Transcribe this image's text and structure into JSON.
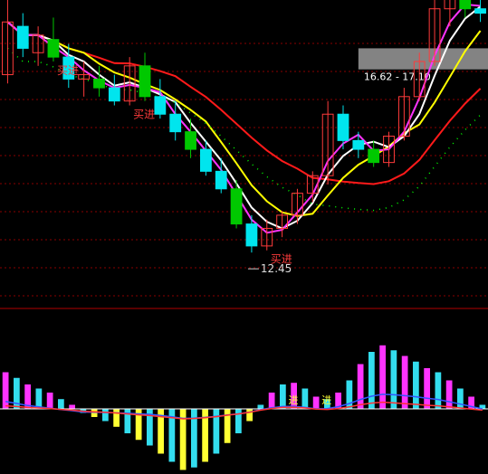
{
  "chart_data": [
    {
      "type": "candlestick",
      "title": "",
      "ylim": [
        11.3,
        18.2
      ],
      "grid": true,
      "colors": {
        "up": "#ff3b3b",
        "down": "#00e5ee",
        "down_alt": "#00c800",
        "ma_white": "#ffffff",
        "ma_yellow": "#ffff00",
        "ma_magenta": "#ff33ff",
        "ma_red": "#ff1a1a",
        "band_green": "#00ff00",
        "zone_gray": "#9a9a9a",
        "grid": "#8a0000"
      },
      "candles": [
        {
          "o": 16.5,
          "h": 18.4,
          "l": 16.3,
          "c": 17.7
        },
        {
          "o": 17.6,
          "h": 17.9,
          "l": 16.9,
          "c": 17.1
        },
        {
          "o": 17.0,
          "h": 17.6,
          "l": 16.7,
          "c": 17.4
        },
        {
          "o": 17.3,
          "h": 17.8,
          "l": 16.8,
          "c": 16.9
        },
        {
          "o": 16.9,
          "h": 17.2,
          "l": 16.2,
          "c": 16.4
        },
        {
          "o": 16.4,
          "h": 16.8,
          "l": 16.0,
          "c": 16.5
        },
        {
          "o": 16.4,
          "h": 16.7,
          "l": 16.0,
          "c": 16.2
        },
        {
          "o": 16.2,
          "h": 16.5,
          "l": 15.8,
          "c": 15.9
        },
        {
          "o": 15.9,
          "h": 16.9,
          "l": 15.8,
          "c": 16.7
        },
        {
          "o": 16.7,
          "h": 17.0,
          "l": 15.9,
          "c": 16.0
        },
        {
          "o": 16.0,
          "h": 16.4,
          "l": 15.5,
          "c": 15.6
        },
        {
          "o": 15.6,
          "h": 15.9,
          "l": 15.0,
          "c": 15.2
        },
        {
          "o": 15.2,
          "h": 15.5,
          "l": 14.6,
          "c": 14.8
        },
        {
          "o": 14.8,
          "h": 15.0,
          "l": 14.2,
          "c": 14.3
        },
        {
          "o": 14.3,
          "h": 14.6,
          "l": 13.8,
          "c": 13.9
        },
        {
          "o": 13.9,
          "h": 14.1,
          "l": 13.0,
          "c": 13.1
        },
        {
          "o": 13.1,
          "h": 13.3,
          "l": 12.45,
          "c": 12.6
        },
        {
          "o": 12.6,
          "h": 13.2,
          "l": 12.5,
          "c": 13.0
        },
        {
          "o": 13.0,
          "h": 13.4,
          "l": 12.8,
          "c": 13.3
        },
        {
          "o": 13.3,
          "h": 13.9,
          "l": 13.1,
          "c": 13.8
        },
        {
          "o": 13.8,
          "h": 14.3,
          "l": 13.6,
          "c": 14.2
        },
        {
          "o": 14.2,
          "h": 15.9,
          "l": 14.0,
          "c": 15.6
        },
        {
          "o": 15.6,
          "h": 15.8,
          "l": 14.8,
          "c": 15.0
        },
        {
          "o": 15.0,
          "h": 15.2,
          "l": 14.6,
          "c": 14.8
        },
        {
          "o": 14.8,
          "h": 15.0,
          "l": 14.4,
          "c": 14.5
        },
        {
          "o": 14.5,
          "h": 15.2,
          "l": 14.4,
          "c": 15.1
        },
        {
          "o": 15.1,
          "h": 16.2,
          "l": 15.0,
          "c": 16.0
        },
        {
          "o": 16.0,
          "h": 17.0,
          "l": 15.9,
          "c": 16.8
        },
        {
          "o": 16.8,
          "h": 18.2,
          "l": 16.7,
          "c": 18.0
        },
        {
          "o": 18.0,
          "h": 18.6,
          "l": 17.6,
          "c": 18.3
        },
        {
          "o": 18.3,
          "h": 18.5,
          "l": 17.8,
          "c": 18.0
        },
        {
          "o": 18.0,
          "h": 18.3,
          "l": 17.7,
          "c": 17.9
        }
      ],
      "markers": [
        {
          "text": "买进",
          "candle": 3
        },
        {
          "text": "买进",
          "candle": 8
        },
        {
          "text": "买进",
          "candle": 17
        }
      ],
      "low_label": {
        "text": "12.45",
        "value": 12.45,
        "candle": 16
      },
      "zone": {
        "text": "16.62 - 17.10",
        "low": 16.62,
        "high": 17.1
      }
    },
    {
      "type": "bar",
      "title": "",
      "ylim": [
        -1.0,
        1.0
      ],
      "grid": false,
      "zero_line": true,
      "histogram": [
        0.45,
        0.38,
        0.3,
        0.25,
        0.2,
        0.12,
        0.05,
        -0.05,
        -0.1,
        -0.15,
        -0.22,
        -0.3,
        -0.38,
        -0.45,
        -0.55,
        -0.65,
        -0.75,
        -0.72,
        -0.65,
        -0.55,
        -0.42,
        -0.3,
        -0.15,
        0.05,
        0.2,
        0.3,
        0.32,
        0.25,
        0.15,
        0.12,
        0.2,
        0.35,
        0.55,
        0.7,
        0.78,
        0.72,
        0.65,
        0.58,
        0.5,
        0.45,
        0.35,
        0.25,
        0.15,
        0.05
      ],
      "markers": [
        {
          "text": "进"
        },
        {
          "text": "进"
        }
      ]
    }
  ]
}
